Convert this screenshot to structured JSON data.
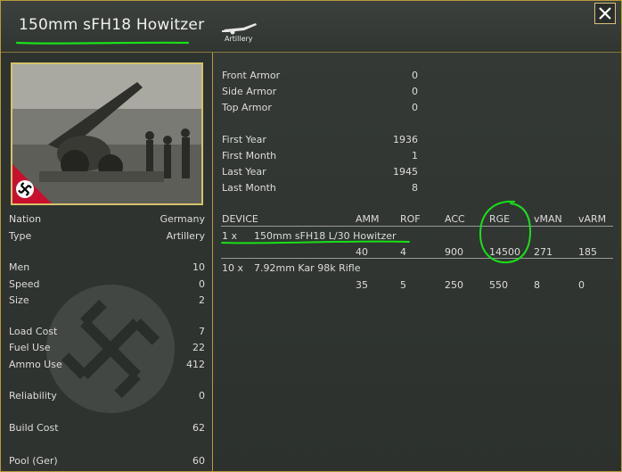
{
  "header": {
    "title": "150mm sFH18 Howitzer",
    "unit_type_label": "Artillery",
    "icons": {
      "unit_type": "artillery-gun-icon",
      "close": "close-icon"
    }
  },
  "colors": {
    "accent_gold": "#b89a3a",
    "annotation_green": "#19e019",
    "flag_red": "#c8102e"
  },
  "left": {
    "photo_icon": "howitzer-photo",
    "flag_icon": "swastika-flag-icon",
    "nation_label": "Nation",
    "nation_value": "Germany",
    "type_label": "Type",
    "type_value": "Artillery",
    "men_label": "Men",
    "men_value": "10",
    "speed_label": "Speed",
    "speed_value": "0",
    "size_label": "Size",
    "size_value": "2",
    "load_cost_label": "Load Cost",
    "load_cost_value": "7",
    "fuel_use_label": "Fuel Use",
    "fuel_use_value": "22",
    "ammo_use_label": "Ammo Use",
    "ammo_use_value": "412",
    "reliability_label": "Reliability",
    "reliability_value": "0",
    "build_cost_label": "Build Cost",
    "build_cost_value": "62",
    "pool_label": "Pool (Ger)",
    "pool_value": "60"
  },
  "armor": {
    "front_label": "Front Armor",
    "front_value": "0",
    "side_label": "Side Armor",
    "side_value": "0",
    "top_label": "Top Armor",
    "top_value": "0"
  },
  "dates": {
    "first_year_label": "First Year",
    "first_year_value": "1936",
    "first_month_label": "First Month",
    "first_month_value": "1",
    "last_year_label": "Last Year",
    "last_year_value": "1945",
    "last_month_label": "Last Month",
    "last_month_value": "8"
  },
  "devices": {
    "headers": {
      "device": "DEVICE",
      "amm": "AMM",
      "rof": "ROF",
      "acc": "ACC",
      "rge": "RGE",
      "vman": "vMAN",
      "varm": "vARM"
    },
    "rows": [
      {
        "qty": "1 x",
        "name": "150mm sFH18 L/30 Howitzer",
        "amm": "40",
        "rof": "4",
        "acc": "900",
        "rge": "14500",
        "vman": "271",
        "varm": "185"
      },
      {
        "qty": "10 x",
        "name": "7.92mm Kar 98k Rifle",
        "amm": "35",
        "rof": "5",
        "acc": "250",
        "rge": "550",
        "vman": "8",
        "varm": "0"
      }
    ]
  }
}
